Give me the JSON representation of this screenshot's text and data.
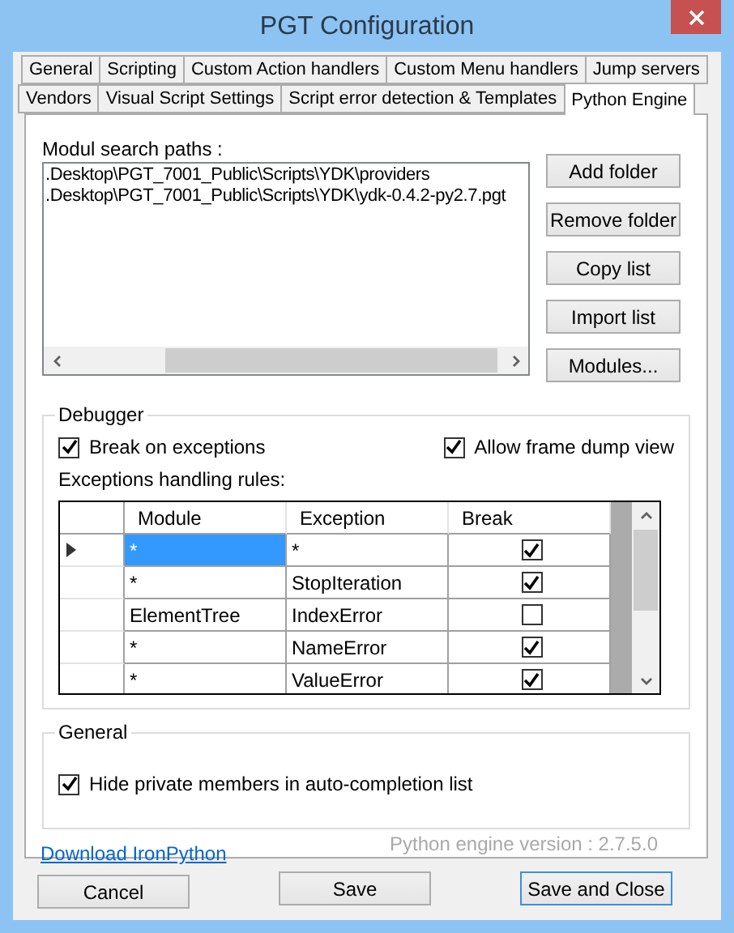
{
  "window": {
    "title": "PGT Configuration"
  },
  "tab_rows": [
    [
      {
        "label": "General",
        "selected": false
      },
      {
        "label": "Scripting",
        "selected": false
      },
      {
        "label": "Custom Action handlers",
        "selected": false
      },
      {
        "label": "Custom Menu handlers",
        "selected": false
      },
      {
        "label": "Jump servers",
        "selected": false
      }
    ],
    [
      {
        "label": "Vendors",
        "selected": false
      },
      {
        "label": "Visual Script Settings",
        "selected": false
      },
      {
        "label": "Script error detection & Templates",
        "selected": false
      },
      {
        "label": "Python Engine",
        "selected": true
      }
    ]
  ],
  "search_paths": {
    "label": "Modul search paths :",
    "items": [
      ".Desktop\\PGT_7001_Public\\Scripts\\YDK\\providers",
      ".Desktop\\PGT_7001_Public\\Scripts\\YDK\\ydk-0.4.2-py2.7.pgt"
    ],
    "buttons": [
      "Add folder",
      "Remove folder",
      "Copy list",
      "Import list",
      "Modules..."
    ]
  },
  "debugger": {
    "title": "Debugger",
    "break_on_exceptions": {
      "label": "Break on exceptions",
      "checked": true
    },
    "allow_frame_dump": {
      "label": "Allow frame dump view",
      "checked": true
    },
    "rules_label": "Exceptions handling rules:",
    "table": {
      "columns": [
        "Module",
        "Exception",
        "Break"
      ],
      "rows": [
        {
          "module": "*",
          "exception": "*",
          "break": true,
          "selected": true
        },
        {
          "module": "*",
          "exception": "StopIteration",
          "break": true,
          "selected": false
        },
        {
          "module": "ElementTree",
          "exception": "IndexError",
          "break": false,
          "selected": false
        },
        {
          "module": "*",
          "exception": "NameError",
          "break": true,
          "selected": false
        },
        {
          "module": "*",
          "exception": "ValueError",
          "break": true,
          "selected": false
        }
      ]
    }
  },
  "general": {
    "title": "General",
    "hide_private": {
      "label": "Hide private members in auto-completion list",
      "checked": true
    }
  },
  "download_link": "Download IronPython",
  "version": "Python engine version : 2.7.5.0",
  "footer_buttons": [
    {
      "label": "Cancel",
      "focused": false
    },
    {
      "label": "Save",
      "focused": false
    },
    {
      "label": "Save and Close",
      "focused": true
    }
  ]
}
